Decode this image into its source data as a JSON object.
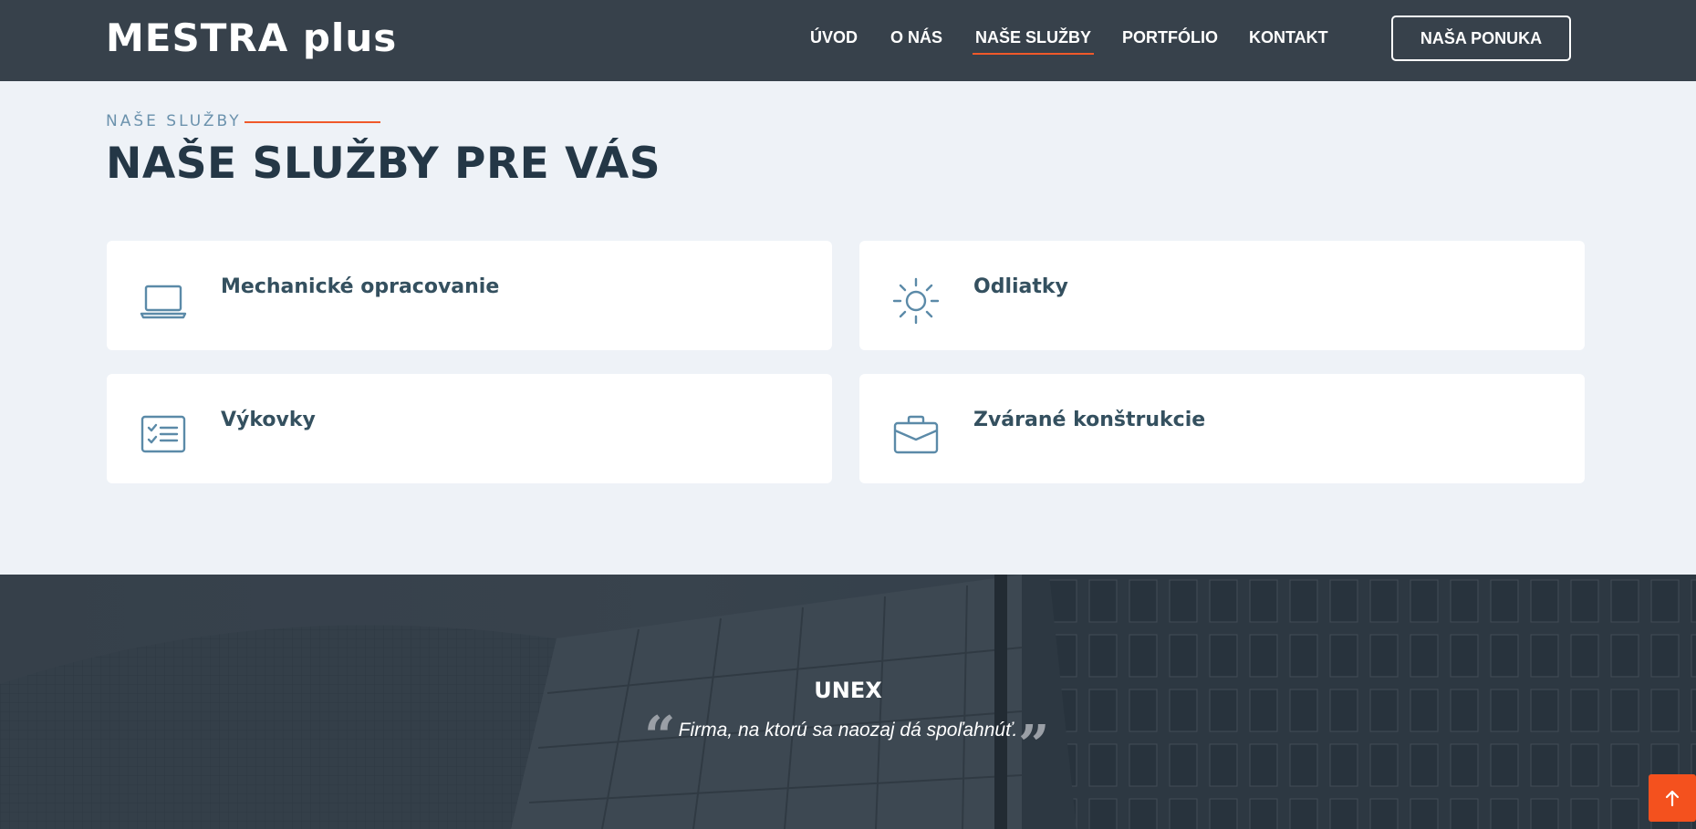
{
  "header": {
    "logo": "MESTRA plus",
    "nav": [
      "ÚVOD",
      "O NÁS",
      "NAŠE SLUŽBY",
      "PORTFÓLIO",
      "KONTAKT"
    ],
    "active_nav": "NAŠE SLUŽBY",
    "cta_label": "NAŠA PONUKA"
  },
  "services": {
    "eyebrow": "NAŠE SLUŽBY",
    "title": "NAŠE SLUŽBY PRE VÁS",
    "items": [
      {
        "title": "Mechanické opracovanie",
        "icon": "laptop-icon"
      },
      {
        "title": "Odliatky",
        "icon": "sun-icon"
      },
      {
        "title": "Výkovky",
        "icon": "checklist-icon"
      },
      {
        "title": "Zvárané konštrukcie",
        "icon": "briefcase-icon"
      }
    ]
  },
  "testimonial": {
    "name": "UNEX",
    "quote": "Firma, na ktorú sa naozaj dá spoľahnúť.",
    "open_mark": "“",
    "close_mark": "”"
  },
  "colors": {
    "header_bg": "#37414b",
    "accent": "#f0592a",
    "title": "#243746",
    "card_title": "#34505f",
    "icon": "#5b8aa8",
    "page_bg": "#eef2f7"
  },
  "scroll_top_icon": "arrow-up-icon"
}
